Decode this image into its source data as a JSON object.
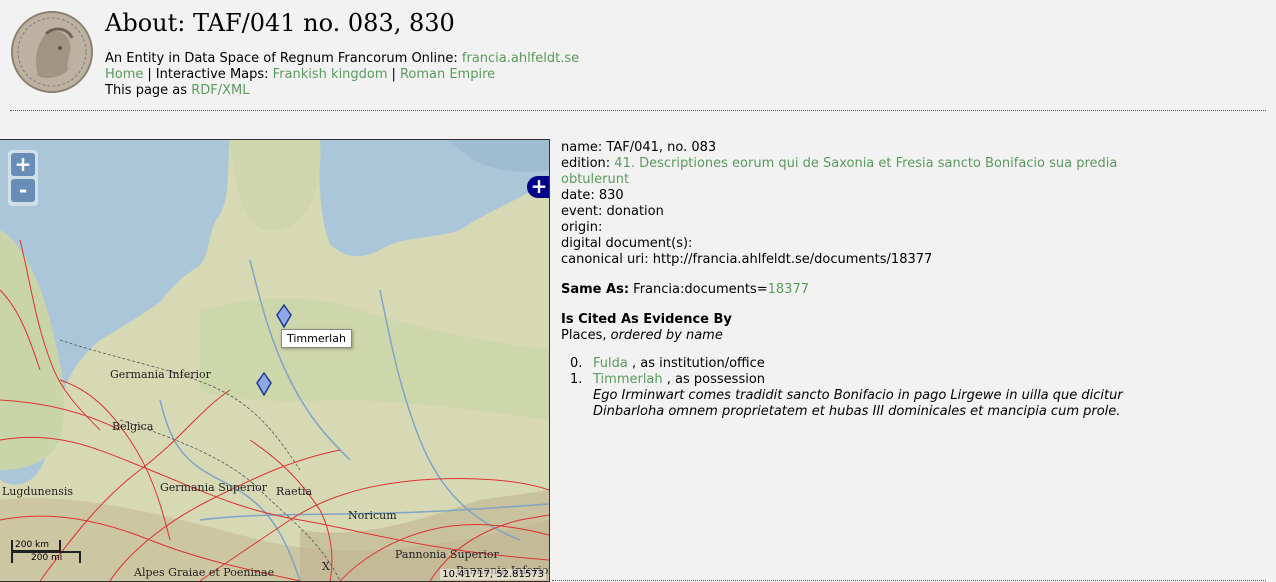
{
  "header": {
    "title": "About: TAF/041 no. 083, 830",
    "entity_prefix": "An Entity in Data Space of Regnum Francorum Online:",
    "entity_link": "francia.ahlfeldt.se",
    "nav_home": "Home",
    "nav_sep1": "|",
    "nav_maps_prefix": "Interactive Maps:",
    "nav_frankish": "Frankish kingdom",
    "nav_sep2": "|",
    "nav_roman": "Roman Empire",
    "page_as_prefix": "This page as",
    "page_as_link": "RDF/XML"
  },
  "map": {
    "zoom_in": "+",
    "zoom_out": "-",
    "layer_switcher": "+",
    "tooltip": "Timmerlah",
    "scale_km": "200 km",
    "scale_mi": "200 mi",
    "coords": "10.41717, 52.81573",
    "labels": {
      "germania_inferior": "Germania Inferior",
      "belgica": "Belgica",
      "lugdunensis": "Lugdunensis",
      "germania_superior": "Germania Superior",
      "raetia": "Raetia",
      "noricum": "Noricum",
      "pannonia_superior": "Pannonia Superior",
      "pannonia_inferior": "Pannonia Inferior",
      "alpes": "Alpes Graiae et Poeninae",
      "x": "X"
    }
  },
  "details": {
    "name_label": "name:",
    "name_value": "TAF/041, no. 083",
    "edition_label": "edition:",
    "edition_link": "41. Descriptiones eorum qui de Saxonia et Fresia sancto Bonifacio sua predia obtulerunt",
    "date_label": "date:",
    "date_value": "830",
    "event_label": "event:",
    "event_value": "donation",
    "origin_label": "origin:",
    "digital_label": "digital document(s):",
    "uri_label": "canonical uri:",
    "uri_value": "http://francia.ahlfeldt.se/documents/18377",
    "same_as_label": "Same As:",
    "same_as_prefix": "Francia:documents=",
    "same_as_link": "18377",
    "cited_heading": "Is Cited As Evidence By",
    "places_prefix": "Places,",
    "places_order": "ordered by name",
    "places": [
      {
        "index": "0.",
        "name": "Fulda",
        "role": ", as institution/office",
        "quote": ""
      },
      {
        "index": "1.",
        "name": "Timmerlah",
        "role": ", as possession",
        "quote": "Ego Irminwart comes tradidit sancto Bonifacio in pago Lirgewe in uilla que dicitur Dinbarloha omnem proprietatem et hubas III dominicales et mancipia cum prole."
      }
    ]
  }
}
